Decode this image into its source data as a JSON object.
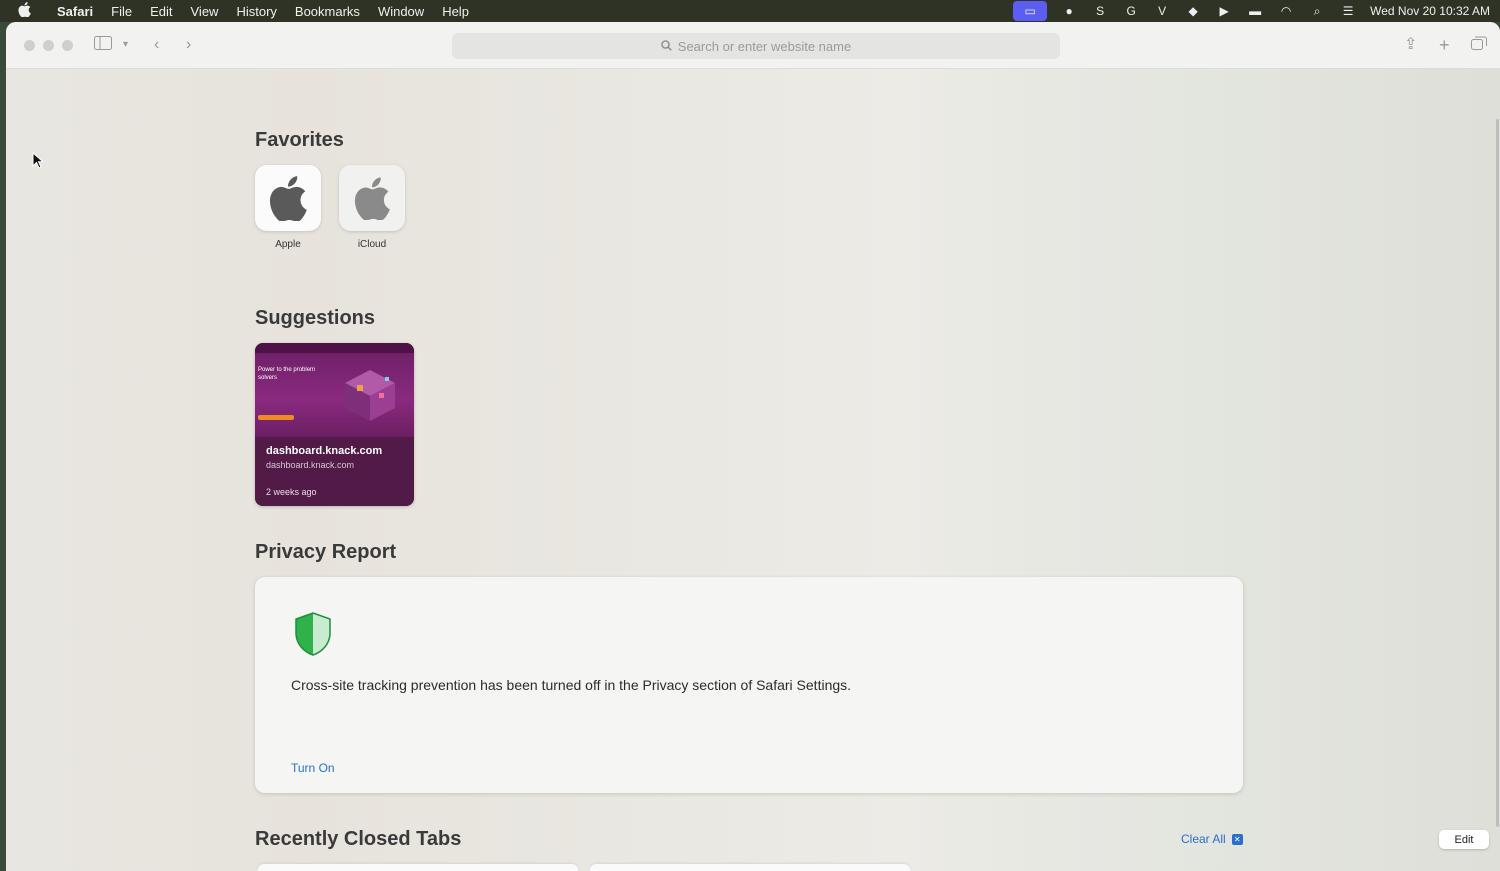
{
  "menubar": {
    "app_name": "Safari",
    "items": [
      "File",
      "Edit",
      "View",
      "History",
      "Bookmarks",
      "Window",
      "Help"
    ],
    "status_icons": [
      "screen-share-icon",
      "github-icon",
      "scribe-icon",
      "grammarly-icon",
      "vectorworks-icon",
      "sketch-icon",
      "play-icon",
      "battery-icon",
      "wifi-icon",
      "spotlight-icon",
      "control-center-icon"
    ],
    "clock": "Wed Nov 20  10:32 AM"
  },
  "toolbar": {
    "search_placeholder": "Search or enter website name"
  },
  "favorites": {
    "title": "Favorites",
    "items": [
      {
        "label": "Apple",
        "icon": "apple-logo-icon"
      },
      {
        "label": "iCloud",
        "icon": "apple-logo-icon"
      }
    ]
  },
  "suggestions": {
    "title": "Suggestions",
    "items": [
      {
        "title": "dashboard.knack.com",
        "url": "dashboard.knack.com",
        "time": "2 weeks ago",
        "thumb_heading": "Power to the problem solvers"
      }
    ]
  },
  "privacy": {
    "title": "Privacy Report",
    "message": "Cross-site tracking prevention has been turned off in the Privacy section of Safari Settings.",
    "action": "Turn On"
  },
  "recently_closed": {
    "title": "Recently Closed Tabs",
    "clear_all": "Clear All",
    "edit": "Edit"
  },
  "colors": {
    "accent": "#2a6fcf",
    "shield_green": "#2fb24a",
    "suggestion_bg": "#521a47"
  }
}
